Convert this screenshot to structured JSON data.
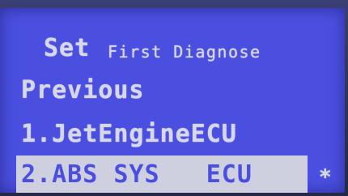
{
  "screen": {
    "title_set": "Set",
    "title_rest": "First Diagnose",
    "previous_label": "Previous",
    "items": [
      {
        "label": "1.JetEngineECU"
      },
      {
        "label": "2.ABS SYS   ECU"
      }
    ],
    "selection_marker": "*"
  },
  "colors": {
    "lcd_background": "#4a4fe0",
    "lcd_text": "#d7d7e6",
    "selection_bar": "#cfd0df"
  }
}
